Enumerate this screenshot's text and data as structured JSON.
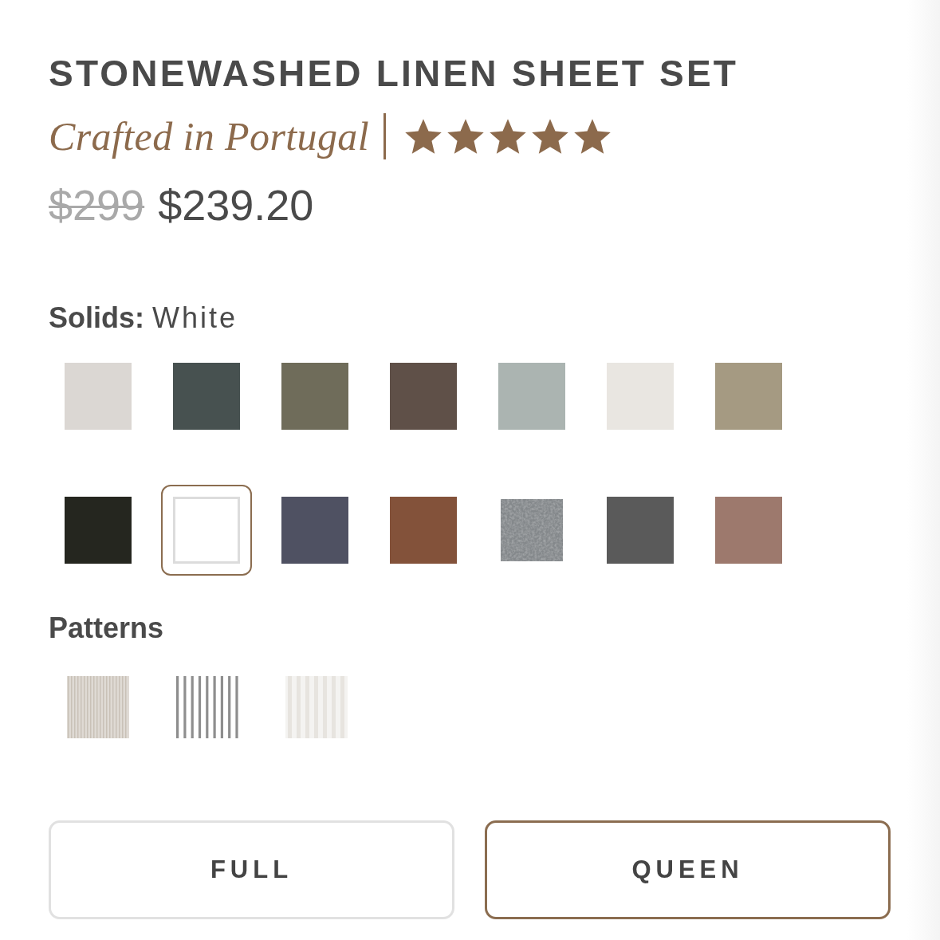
{
  "product": {
    "title": "STONEWASHED LINEN SHEET SET",
    "origin": "Crafted in Portugal",
    "stars": 5,
    "original_price": "$299",
    "price": "$239.20"
  },
  "solids": {
    "label": "Solids:",
    "value": "White",
    "swatches": [
      {
        "kind": "solid",
        "color": "#dbd7d3",
        "selected": false
      },
      {
        "kind": "solid",
        "color": "#475150",
        "selected": false
      },
      {
        "kind": "solid",
        "color": "#6f6c5a",
        "selected": false
      },
      {
        "kind": "solid",
        "color": "#5f5048",
        "selected": false
      },
      {
        "kind": "solid",
        "color": "#abb4b1",
        "selected": false
      },
      {
        "kind": "solid",
        "color": "#e9e6e1",
        "selected": false
      },
      {
        "kind": "solid",
        "color": "#a59a82",
        "selected": false
      },
      {
        "kind": "solid",
        "color": "#25261f",
        "selected": false
      },
      {
        "kind": "solid",
        "color": "#ffffff",
        "selected": true
      },
      {
        "kind": "solid",
        "color": "#4f5162",
        "selected": false
      },
      {
        "kind": "solid",
        "color": "#83523a",
        "selected": false
      },
      {
        "kind": "texture",
        "color": "#84888b",
        "selected": false
      },
      {
        "kind": "solid",
        "color": "#5a5a5a",
        "selected": false
      },
      {
        "kind": "solid",
        "color": "#9d796d",
        "selected": false
      }
    ]
  },
  "patterns": {
    "label": "Patterns",
    "swatches": [
      {
        "kind": "pinstripe",
        "color": "#c9c1b7",
        "selected": false
      },
      {
        "kind": "ticking",
        "color": "#8e8e8e",
        "selected": false
      },
      {
        "kind": "wide-stripe",
        "color": "#e7e4df",
        "selected": false
      }
    ]
  },
  "sizes": [
    {
      "label": "FULL",
      "selected": false
    },
    {
      "label": "QUEEN",
      "selected": true
    }
  ]
}
